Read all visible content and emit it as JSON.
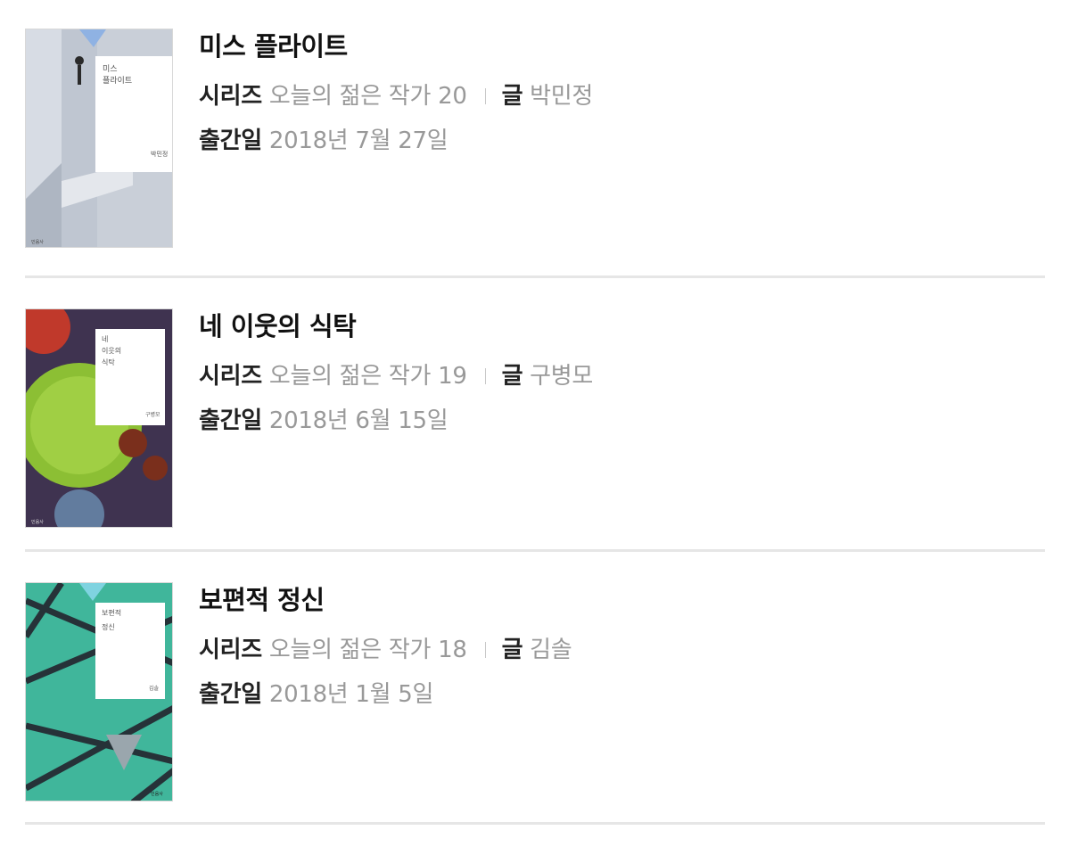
{
  "books": [
    {
      "title": "미스 플라이트",
      "series_label": "시리즈",
      "series": "오늘의 젊은 작가 20",
      "author_label": "글",
      "author": "박민정",
      "date_label": "출간일",
      "date": "2018년 7월 27일",
      "cover": {
        "title_line1": "미스",
        "title_line2": "플라이트",
        "author": "박민정",
        "bg": "#c4cbd6",
        "accent": "#9fb4d8"
      }
    },
    {
      "title": "네 이웃의 식탁",
      "series_label": "시리즈",
      "series": "오늘의 젊은 작가 19",
      "author_label": "글",
      "author": "구병모",
      "date_label": "출간일",
      "date": "2018년 6월 15일",
      "cover": {
        "title_line1": "네",
        "title_line2": "이웃의",
        "title_line3": "식탁",
        "author": "구병모",
        "bg": "#4a3a55",
        "accent": "#8fbf3a"
      }
    },
    {
      "title": "보편적 정신",
      "series_label": "시리즈",
      "series": "오늘의 젊은 작가 18",
      "author_label": "글",
      "author": "김솔",
      "date_label": "출간일",
      "date": "2018년 1월 5일",
      "cover": {
        "title_line1": "보편적",
        "title_line2": "정신",
        "author": "김솔",
        "bg": "#3fb59a",
        "accent": "#2a3a40"
      }
    }
  ]
}
